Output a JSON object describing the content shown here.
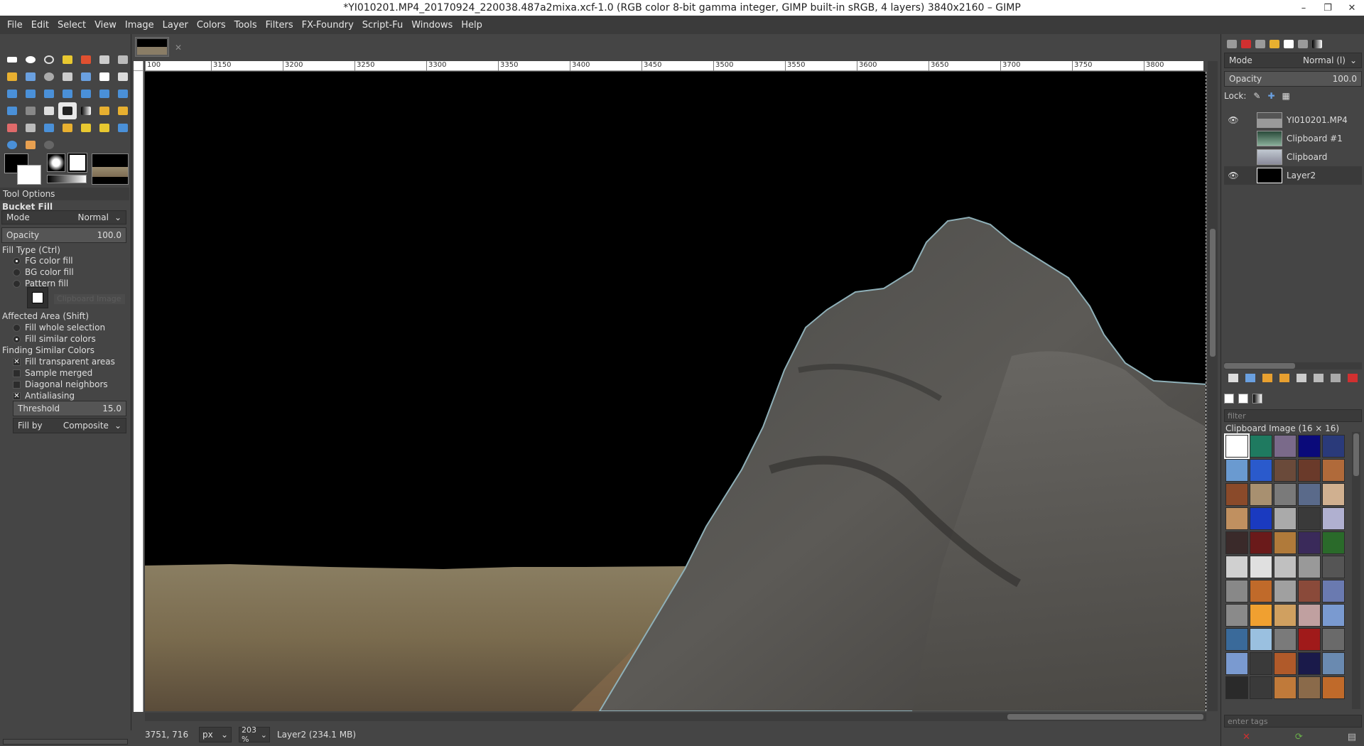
{
  "window": {
    "title": "*YI010201.MP4_20170924_220038.487a2mixa.xcf-1.0 (RGB color 8-bit gamma integer, GIMP built-in sRGB, 4 layers) 3840x2160 – GIMP",
    "minimize": "–",
    "maximize": "❐",
    "close": "✕"
  },
  "menubar": [
    "File",
    "Edit",
    "Select",
    "View",
    "Image",
    "Layer",
    "Colors",
    "Tools",
    "Filters",
    "FX-Foundry",
    "Script-Fu",
    "Windows",
    "Help"
  ],
  "tool_options": {
    "header": "Tool Options",
    "tool_name": "Bucket Fill",
    "mode_label": "Mode",
    "mode_value": "Normal",
    "opacity_label": "Opacity",
    "opacity_value": "100.0",
    "fill_type_label": "Fill Type  (Ctrl)",
    "fill_fg": "FG color fill",
    "fill_bg": "BG color fill",
    "fill_pattern": "Pattern fill",
    "pattern_name": "Clipboard Image",
    "affected_area_label": "Affected Area  (Shift)",
    "area_whole": "Fill whole selection",
    "area_similar": "Fill similar colors",
    "finding_label": "Finding Similar Colors",
    "fill_transparent": "Fill transparent areas",
    "sample_merged": "Sample merged",
    "diagonal": "Diagonal neighbors",
    "antialiasing": "Antialiasing",
    "threshold_label": "Threshold",
    "threshold_value": "15.0",
    "fill_by_label": "Fill by",
    "fill_by_value": "Composite"
  },
  "ruler_labels": [
    "100",
    "3150",
    "3200",
    "3250",
    "3300",
    "3350",
    "3400",
    "3450",
    "3500",
    "3550",
    "3600",
    "3650",
    "3700",
    "3750",
    "3800"
  ],
  "status": {
    "coords": "3751, 716",
    "unit": "px",
    "zoom": "203 %",
    "layer_info": "Layer2 (234.1 MB)"
  },
  "layers_panel": {
    "mode_label": "Mode",
    "mode_value": "Normal (l)",
    "opacity_label": "Opacity",
    "opacity_value": "100.0",
    "lock_label": "Lock:",
    "layers": [
      {
        "name": "YI010201.MP4",
        "visible": true
      },
      {
        "name": "Clipboard #1",
        "visible": false
      },
      {
        "name": "Clipboard",
        "visible": false
      },
      {
        "name": "Layer2",
        "visible": true
      }
    ]
  },
  "patterns_panel": {
    "filter_placeholder": "filter",
    "current_pattern": "Clipboard Image (16 × 16)",
    "tags_placeholder": "enter tags",
    "colors": [
      "#ffffff",
      "#1f7a60",
      "#7a6a8a",
      "#0a0a7a",
      "#2a3a7a",
      "#6a9ad0",
      "#2a5acc",
      "#6a4a3a",
      "#6a3a2a",
      "#b06a3a",
      "#8a4a2a",
      "#a89070",
      "#7a7a7a",
      "#5a6a8a",
      "#d0b090",
      "#c09060",
      "#1a3ac0",
      "#aaaaaa",
      "#3a3a3a",
      "#b0b0d0",
      "#3a2a2a",
      "#6a1a1a",
      "#b07a3a",
      "#3a2a5a",
      "#2a6a2a",
      "#d0d0d0",
      "#e0e0e0",
      "#c0c0c0",
      "#999999",
      "#555555",
      "#888888",
      "#c06a2a",
      "#a0a0a0",
      "#8a4a3a",
      "#6a7ab0",
      "#8a8a8a",
      "#f0a030",
      "#d0a060",
      "#c0a0a0",
      "#7a9ad0",
      "#3a6a9a",
      "#9ac0e0",
      "#7a7a7a",
      "#a01a1a",
      "#6a6a6a",
      "#7a9ad0",
      "#3a3a3a",
      "#b05a2a",
      "#1a1a4a",
      "#6a8ab0",
      "#2a2a2a",
      "#3a3a3a",
      "#c07a3a",
      "#8a6a4a",
      "#c06a2a"
    ]
  }
}
